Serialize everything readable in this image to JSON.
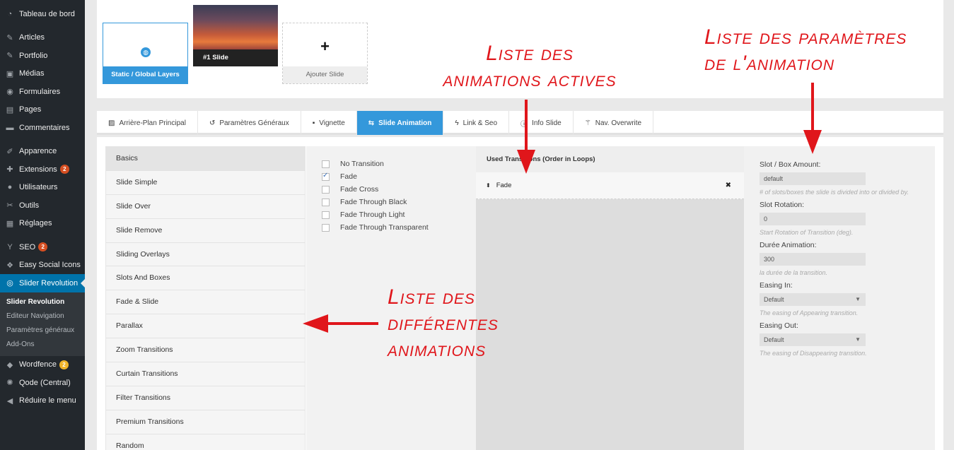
{
  "sidebar": {
    "items": [
      {
        "label": "Tableau de bord",
        "icon": "dashboard-icon",
        "glyph": "◔"
      },
      {
        "label": "Articles",
        "icon": "pin-icon",
        "glyph": "✎"
      },
      {
        "label": "Portfolio",
        "icon": "pin-icon",
        "glyph": "✎"
      },
      {
        "label": "Médias",
        "icon": "media-icon",
        "glyph": "▣"
      },
      {
        "label": "Formulaires",
        "icon": "forms-icon",
        "glyph": "◉"
      },
      {
        "label": "Pages",
        "icon": "pages-icon",
        "glyph": "▤"
      },
      {
        "label": "Commentaires",
        "icon": "comment-icon",
        "glyph": "▬"
      },
      {
        "label": "Apparence",
        "icon": "appearance-icon",
        "glyph": "✐"
      },
      {
        "label": "Extensions",
        "icon": "plugin-icon",
        "glyph": "✚",
        "badge": "2"
      },
      {
        "label": "Utilisateurs",
        "icon": "user-icon",
        "glyph": "●"
      },
      {
        "label": "Outils",
        "icon": "wrench-icon",
        "glyph": "✂"
      },
      {
        "label": "Réglages",
        "icon": "settings-icon",
        "glyph": "▦"
      },
      {
        "label": "SEO",
        "icon": "yoast-icon",
        "glyph": "Y",
        "badge": "2"
      },
      {
        "label": "Easy Social Icons",
        "icon": "share-icon",
        "glyph": "❖"
      },
      {
        "label": "Slider Revolution",
        "icon": "slider-revolution-icon",
        "glyph": "◎"
      }
    ],
    "submenu": [
      "Slider Revolution",
      "Editeur Navigation",
      "Paramètres généraux",
      "Add-Ons"
    ],
    "after": [
      {
        "label": "Wordfence",
        "icon": "wordfence-icon",
        "glyph": "◆",
        "badge": "2"
      },
      {
        "label": "Qode (Central)",
        "icon": "gear-icon",
        "glyph": "✺"
      },
      {
        "label": "Réduire le menu",
        "icon": "collapse-icon",
        "glyph": "◀"
      }
    ]
  },
  "slides": {
    "static": "Static / Global Layers",
    "slide1": "#1 Slide",
    "add": "Ajouter Slide",
    "add_symbol": "+"
  },
  "tabs": [
    {
      "label": "Arrière-Plan Principal",
      "icon": "image-icon",
      "glyph": "▨"
    },
    {
      "label": "Paramètres Généraux",
      "icon": "history-icon",
      "glyph": "↺"
    },
    {
      "label": "Vignette",
      "icon": "thumbnail-icon",
      "glyph": "▪"
    },
    {
      "label": "Slide Animation",
      "icon": "animation-icon",
      "glyph": "⇆"
    },
    {
      "label": "Link & Seo",
      "icon": "bolt-icon",
      "glyph": "ϟ"
    },
    {
      "label": "Info Slide",
      "icon": "info-icon",
      "glyph": "ⓘ"
    },
    {
      "label": "Nav. Overwrite",
      "icon": "magic-wand-icon",
      "glyph": "⚚"
    }
  ],
  "categories": [
    "Basics",
    "Slide Simple",
    "Slide Over",
    "Slide Remove",
    "Sliding Overlays",
    "Slots And Boxes",
    "Fade & Slide",
    "Parallax",
    "Zoom Transitions",
    "Curtain Transitions",
    "Filter Transitions",
    "Premium Transitions",
    "Random"
  ],
  "transitions": [
    {
      "label": "No Transition",
      "checked": false
    },
    {
      "label": "Fade",
      "checked": true
    },
    {
      "label": "Fade Cross",
      "checked": false
    },
    {
      "label": "Fade Through Black",
      "checked": false
    },
    {
      "label": "Fade Through Light",
      "checked": false
    },
    {
      "label": "Fade Through Transparent",
      "checked": false
    }
  ],
  "used": {
    "header": "Used Transitions (Order in Loops)",
    "items": [
      "Fade"
    ],
    "sort_glyph": "⬍",
    "remove_glyph": "✖"
  },
  "params": {
    "slot_label": "Slot / Box Amount:",
    "slot_value": "default",
    "slot_help": "# of slots/boxes the slide is divided into or divided by.",
    "rotation_label": "Slot Rotation:",
    "rotation_value": "0",
    "rotation_help": "Start Rotation of Transition (deg).",
    "duration_label": "Durée Animation:",
    "duration_value": "300",
    "duration_help": "la durée de la transition.",
    "easing_in_label": "Easing In:",
    "easing_in_value": "Default",
    "easing_in_help": "The easing of Appearing transition.",
    "easing_out_label": "Easing Out:",
    "easing_out_value": "Default",
    "easing_out_help": "The easing of Disappearing transition.",
    "caret": "▼"
  },
  "annotations": {
    "params_line1": "Liste des paramètres",
    "params_line2": "de l'animation",
    "active_line1": "Liste des",
    "active_line2": "animations actives",
    "diff_line1": "Liste des",
    "diff_line2": "différentes",
    "diff_line3": "animations",
    "color": "#e0161b"
  }
}
